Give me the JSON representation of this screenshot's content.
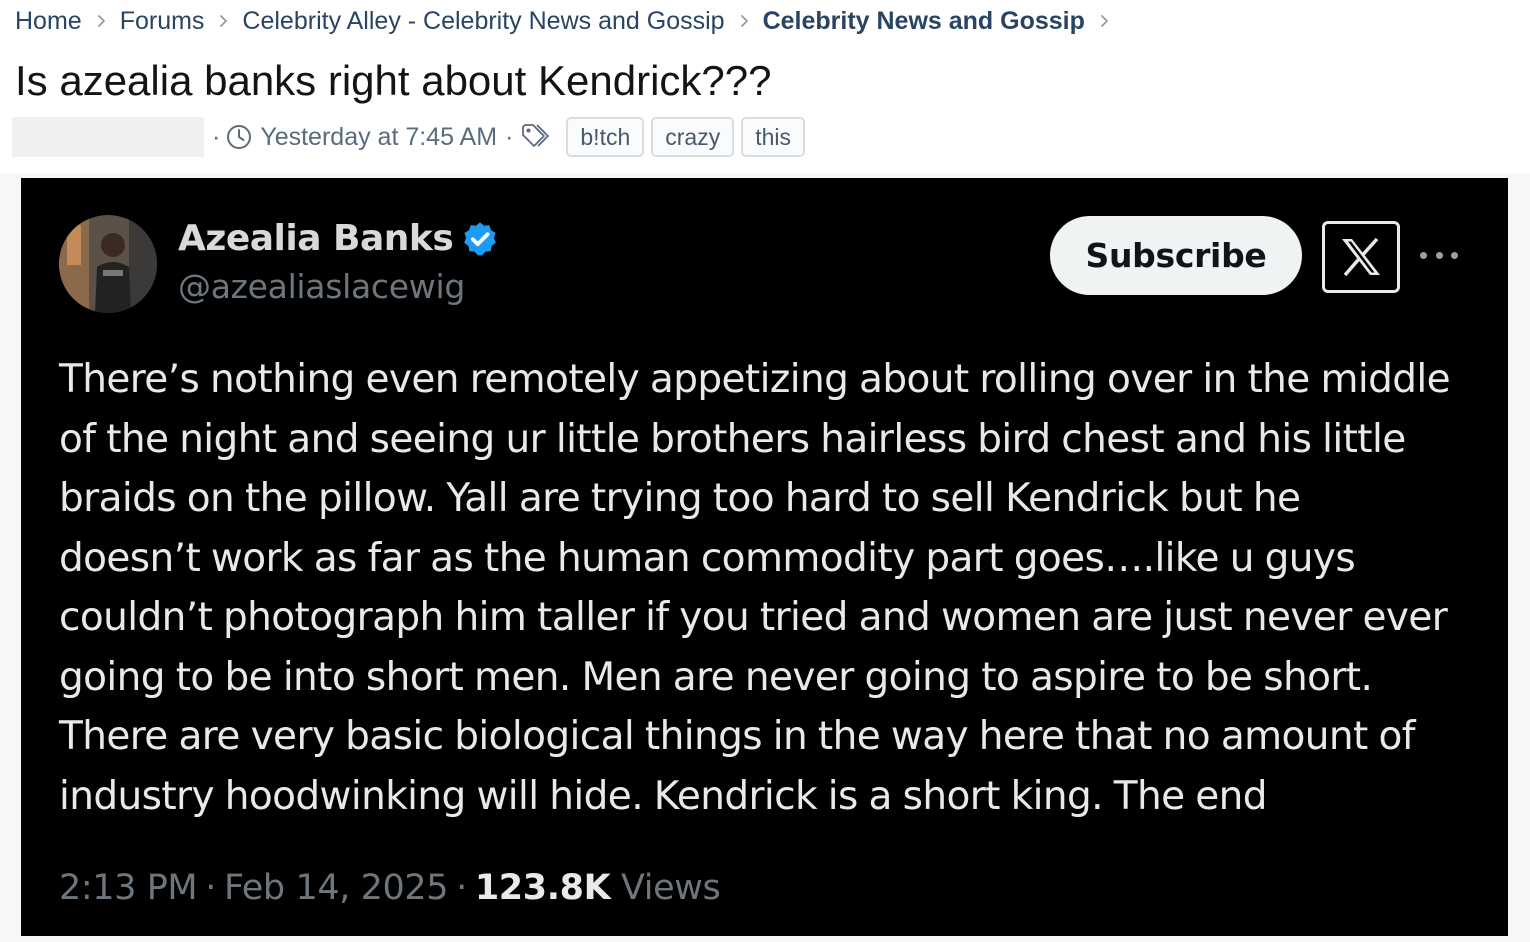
{
  "breadcrumb": {
    "items": [
      "Home",
      "Forums",
      "Celebrity Alley - Celebrity News and Gossip",
      "Celebrity News and Gossip"
    ]
  },
  "thread": {
    "title": "Is azealia banks right about Kendrick???",
    "timestamp": "Yesterday at 7:45 AM",
    "tags": [
      "b!tch",
      "crazy",
      "this"
    ]
  },
  "tweet": {
    "display_name": "Azealia Banks",
    "handle": "@azealiaslacewig",
    "subscribe_label": "Subscribe",
    "text_lines": [
      "There’s nothing even remotely appetizing about rolling over in the middle",
      "of the night and seeing ur little brothers hairless bird chest and his little",
      "braids on the pillow. Yall are trying too hard to sell Kendrick but he",
      "doesn’t work as far as the human commodity part goes….like u guys",
      "couldn’t photograph him taller if you tried and women are just never ever",
      "going to be into short men. Men are never going to aspire to be short.",
      "There are very basic biological things in the way here that no amount of",
      "industry hoodwinking will hide. Kendrick is a short king. The end"
    ],
    "time": "2:13 PM",
    "date": "Feb 14, 2025",
    "views_count": "123.8K",
    "views_label": "Views"
  },
  "icons": {
    "breadcrumb_separator": "chevron-right-icon",
    "timestamp": "clock-icon",
    "tags": "tags-icon",
    "verified": "verified-badge-icon",
    "x_logo": "x-logo-icon",
    "more": "more-options-icon"
  },
  "colors": {
    "link": "#2a4463",
    "tweet_background": "#000000",
    "verified_blue": "#1d9bf0",
    "subscribe_background": "#eff3f4"
  }
}
